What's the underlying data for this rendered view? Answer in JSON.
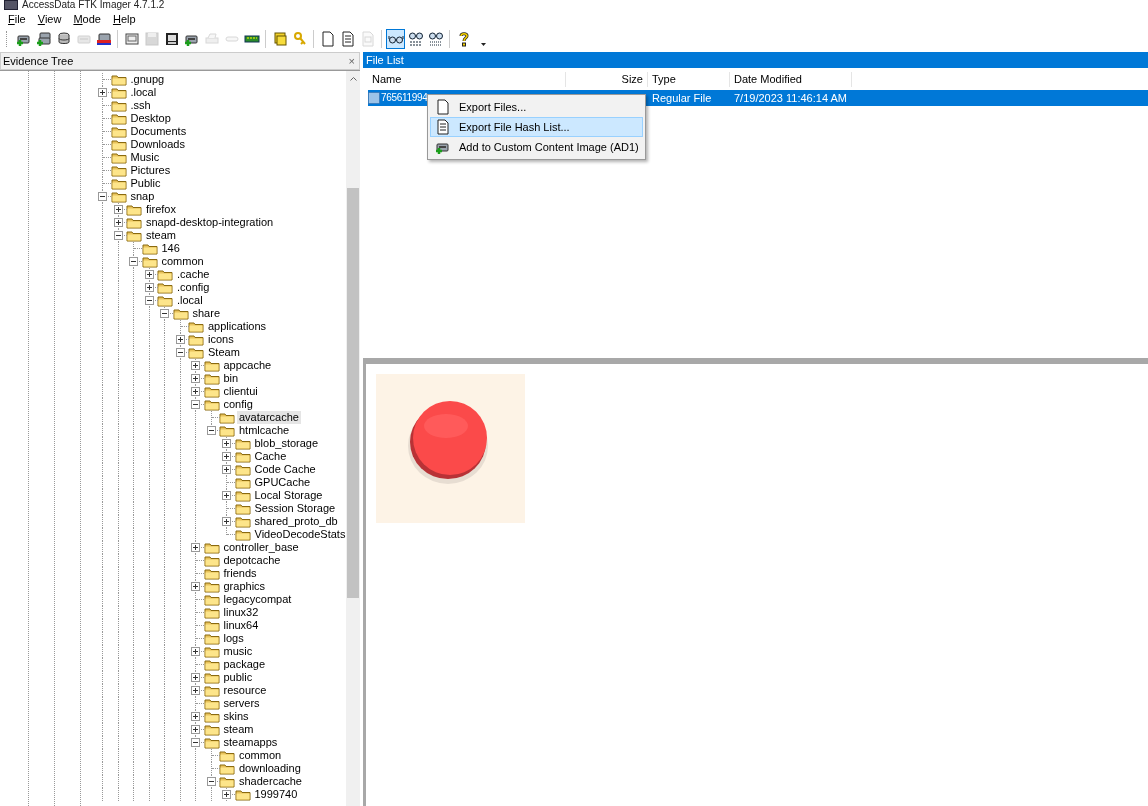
{
  "window": {
    "title": "AccessData FTK Imager 4.7.1.2"
  },
  "menu": [
    "File",
    "View",
    "Mode",
    "Help"
  ],
  "toolbar": [
    {
      "kind": "drive-add",
      "disabled": false,
      "selected": false
    },
    {
      "kind": "drives-add",
      "disabled": false,
      "selected": false
    },
    {
      "kind": "disk-stack",
      "disabled": false,
      "selected": false
    },
    {
      "kind": "drive",
      "disabled": true,
      "selected": false
    },
    {
      "kind": "drive-remove",
      "disabled": false,
      "selected": false
    },
    {
      "kind": "separator"
    },
    {
      "kind": "disk-image",
      "disabled": false,
      "selected": false
    },
    {
      "kind": "floppy",
      "disabled": true,
      "selected": false
    },
    {
      "kind": "film",
      "disabled": false,
      "selected": false
    },
    {
      "kind": "drive-add",
      "disabled": false,
      "selected": false
    },
    {
      "kind": "printer",
      "disabled": true,
      "selected": false
    },
    {
      "kind": "tape",
      "disabled": true,
      "selected": false
    },
    {
      "kind": "memory",
      "disabled": false,
      "selected": false
    },
    {
      "kind": "separator"
    },
    {
      "kind": "folders",
      "disabled": false,
      "selected": false
    },
    {
      "kind": "key",
      "disabled": false,
      "selected": false
    },
    {
      "kind": "separator"
    },
    {
      "kind": "page",
      "disabled": false,
      "selected": false
    },
    {
      "kind": "page-lines",
      "disabled": false,
      "selected": false
    },
    {
      "kind": "page-doc",
      "disabled": true,
      "selected": false
    },
    {
      "kind": "separator"
    },
    {
      "kind": "glasses",
      "disabled": false,
      "selected": true
    },
    {
      "kind": "glasses-text",
      "disabled": false,
      "selected": false
    },
    {
      "kind": "glasses-hex",
      "disabled": false,
      "selected": false
    },
    {
      "kind": "separator"
    },
    {
      "kind": "help",
      "disabled": false,
      "selected": false
    },
    {
      "kind": "caret",
      "disabled": false,
      "selected": false
    }
  ],
  "evidence_tree": {
    "title": "Evidence Tree",
    "close": "×",
    "items": [
      {
        "label": ".gnupg",
        "kind": "leaf",
        "selected": false
      },
      {
        "label": ".local",
        "kind": "collapsed",
        "selected": false
      },
      {
        "label": ".ssh",
        "kind": "leaf",
        "selected": false
      },
      {
        "label": "Desktop",
        "kind": "leaf",
        "selected": false
      },
      {
        "label": "Documents",
        "kind": "leaf",
        "selected": false
      },
      {
        "label": "Downloads",
        "kind": "leaf",
        "selected": false
      },
      {
        "label": "Music",
        "kind": "leaf",
        "selected": false
      },
      {
        "label": "Pictures",
        "kind": "leaf",
        "selected": false
      },
      {
        "label": "Public",
        "kind": "leaf",
        "selected": false
      },
      {
        "label": "snap",
        "kind": "expanded",
        "selected": false,
        "children": [
          {
            "label": "firefox",
            "kind": "collapsed",
            "selected": false
          },
          {
            "label": "snapd-desktop-integration",
            "kind": "collapsed",
            "selected": false
          },
          {
            "label": "steam",
            "kind": "expanded",
            "selected": false,
            "children": [
              {
                "label": "146",
                "kind": "leaf",
                "selected": false
              },
              {
                "label": "common",
                "kind": "expanded",
                "selected": false,
                "children": [
                  {
                    "label": ".cache",
                    "kind": "collapsed",
                    "selected": false
                  },
                  {
                    "label": ".config",
                    "kind": "collapsed",
                    "selected": false
                  },
                  {
                    "label": ".local",
                    "kind": "expanded",
                    "selected": false,
                    "children": [
                      {
                        "label": "share",
                        "kind": "expanded",
                        "selected": false,
                        "children": [
                          {
                            "label": "applications",
                            "kind": "leaf",
                            "selected": false
                          },
                          {
                            "label": "icons",
                            "kind": "collapsed",
                            "selected": false
                          },
                          {
                            "label": "Steam",
                            "kind": "expanded",
                            "selected": false,
                            "children": [
                              {
                                "label": "appcache",
                                "kind": "collapsed",
                                "selected": false
                              },
                              {
                                "label": "bin",
                                "kind": "collapsed",
                                "selected": false
                              },
                              {
                                "label": "clientui",
                                "kind": "collapsed",
                                "selected": false
                              },
                              {
                                "label": "config",
                                "kind": "expanded",
                                "selected": false,
                                "children": [
                                  {
                                    "label": "avatarcache",
                                    "kind": "leaf",
                                    "selected": true
                                  },
                                  {
                                    "label": "htmlcache",
                                    "kind": "expanded",
                                    "selected": false,
                                    "children": [
                                      {
                                        "label": "blob_storage",
                                        "kind": "collapsed",
                                        "selected": false
                                      },
                                      {
                                        "label": "Cache",
                                        "kind": "collapsed",
                                        "selected": false
                                      },
                                      {
                                        "label": "Code Cache",
                                        "kind": "collapsed",
                                        "selected": false
                                      },
                                      {
                                        "label": "GPUCache",
                                        "kind": "leaf",
                                        "selected": false
                                      },
                                      {
                                        "label": "Local Storage",
                                        "kind": "collapsed",
                                        "selected": false
                                      },
                                      {
                                        "label": "Session Storage",
                                        "kind": "leaf",
                                        "selected": false
                                      },
                                      {
                                        "label": "shared_proto_db",
                                        "kind": "collapsed",
                                        "selected": false
                                      },
                                      {
                                        "label": "VideoDecodeStats",
                                        "kind": "leaf",
                                        "selected": false
                                      }
                                    ]
                                  }
                                ]
                              },
                              {
                                "label": "controller_base",
                                "kind": "collapsed",
                                "selected": false
                              },
                              {
                                "label": "depotcache",
                                "kind": "leaf",
                                "selected": false
                              },
                              {
                                "label": "friends",
                                "kind": "leaf",
                                "selected": false
                              },
                              {
                                "label": "graphics",
                                "kind": "collapsed",
                                "selected": false
                              },
                              {
                                "label": "legacycompat",
                                "kind": "leaf",
                                "selected": false
                              },
                              {
                                "label": "linux32",
                                "kind": "leaf",
                                "selected": false
                              },
                              {
                                "label": "linux64",
                                "kind": "leaf",
                                "selected": false
                              },
                              {
                                "label": "logs",
                                "kind": "leaf",
                                "selected": false
                              },
                              {
                                "label": "music",
                                "kind": "collapsed",
                                "selected": false
                              },
                              {
                                "label": "package",
                                "kind": "leaf",
                                "selected": false
                              },
                              {
                                "label": "public",
                                "kind": "collapsed",
                                "selected": false
                              },
                              {
                                "label": "resource",
                                "kind": "collapsed",
                                "selected": false
                              },
                              {
                                "label": "servers",
                                "kind": "leaf",
                                "selected": false
                              },
                              {
                                "label": "skins",
                                "kind": "collapsed",
                                "selected": false
                              },
                              {
                                "label": "steam",
                                "kind": "collapsed",
                                "selected": false
                              },
                              {
                                "label": "steamapps",
                                "kind": "expanded",
                                "selected": false,
                                "children": [
                                  {
                                    "label": "common",
                                    "kind": "leaf",
                                    "selected": false
                                  },
                                  {
                                    "label": "downloading",
                                    "kind": "leaf",
                                    "selected": false
                                  },
                                  {
                                    "label": "shadercache",
                                    "kind": "expanded",
                                    "selected": false,
                                    "children": [
                                      {
                                        "label": "1999740",
                                        "kind": "collapsed",
                                        "selected": false
                                      }
                                    ]
                                  }
                                ]
                              }
                            ]
                          }
                        ]
                      }
                    ]
                  }
                ]
              }
            ]
          }
        ]
      }
    ]
  },
  "file_list": {
    "title": "File List",
    "columns": [
      "Name",
      "Size",
      "Type",
      "Date Modified"
    ],
    "rows": [
      {
        "name": "765611994",
        "type": "Regular File",
        "date_modified": "7/19/2023 11:46:14 AM",
        "selected": true
      }
    ]
  },
  "context_menu": {
    "items": [
      {
        "label": "Export Files...",
        "kind": "page",
        "selected": false
      },
      {
        "label": "Export File Hash List...",
        "kind": "page-lines",
        "selected": true
      },
      {
        "label": "Add to Custom Content Image (AD1)",
        "kind": "drive-add",
        "selected": false
      }
    ]
  }
}
